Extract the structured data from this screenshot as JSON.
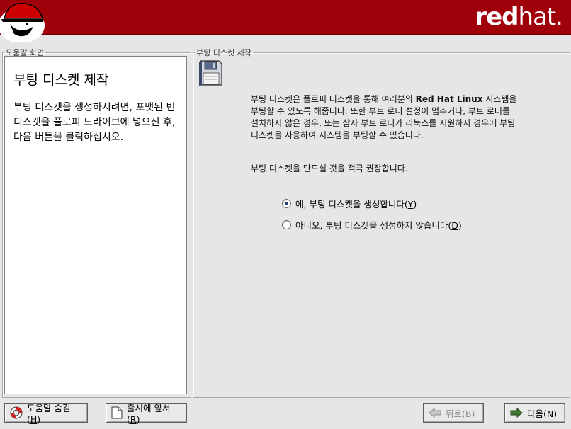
{
  "header": {
    "brand_bold": "red",
    "brand_thin": "hat."
  },
  "help": {
    "legend": "도움말 화면",
    "title": "부팅 디스켓 제작",
    "body": "부팅 디스켓을 생성하시려면, 포맷된 빈 디스켓을 플로피 드라이브에 넣으신 후, 다음 버튼을 클릭하십시오."
  },
  "main": {
    "legend": "부팅 디스켓 제작",
    "desc_before": "부팅 디스켓은 플로피 디스켓을 통해 여러분의 ",
    "desc_strong": "Red Hat Linux",
    "desc_after": " 시스템을 부팅할 수 있도록 해줍니다.  또한 부트 로더 설정이 멈추거나, 부트 로더를 설치하지 않은 경우, 또는 삼자 부트 로더가 리눅스를 지원하지 경우에 부팅 디스켓을 사용하여 시스템을 부팅할 수 있습니다.",
    "advice": "부팅 디스켓을 만드실 것을 적극 권장합니다.",
    "options": [
      {
        "label": "예, 부팅 디스켓을 생성합니다(",
        "key": "Y",
        "suffix": ")",
        "checked": true
      },
      {
        "label": "아니오, 부팅 디스켓을 생성하지 않습니다(",
        "key": "D",
        "suffix": ")",
        "checked": false
      }
    ]
  },
  "buttons": {
    "help": {
      "label": "도움말 숨김(",
      "key": "H",
      "suffix": ")"
    },
    "release": {
      "label": "출시에 앞서(",
      "key": "R",
      "suffix": ")"
    },
    "back": {
      "label": "뒤로(",
      "key": "B",
      "suffix": ")"
    },
    "next": {
      "label": "다음(",
      "key": "N",
      "suffix": ")"
    }
  },
  "colors": {
    "banner": "#a0000a",
    "radio_selected": "#1d3a72"
  }
}
